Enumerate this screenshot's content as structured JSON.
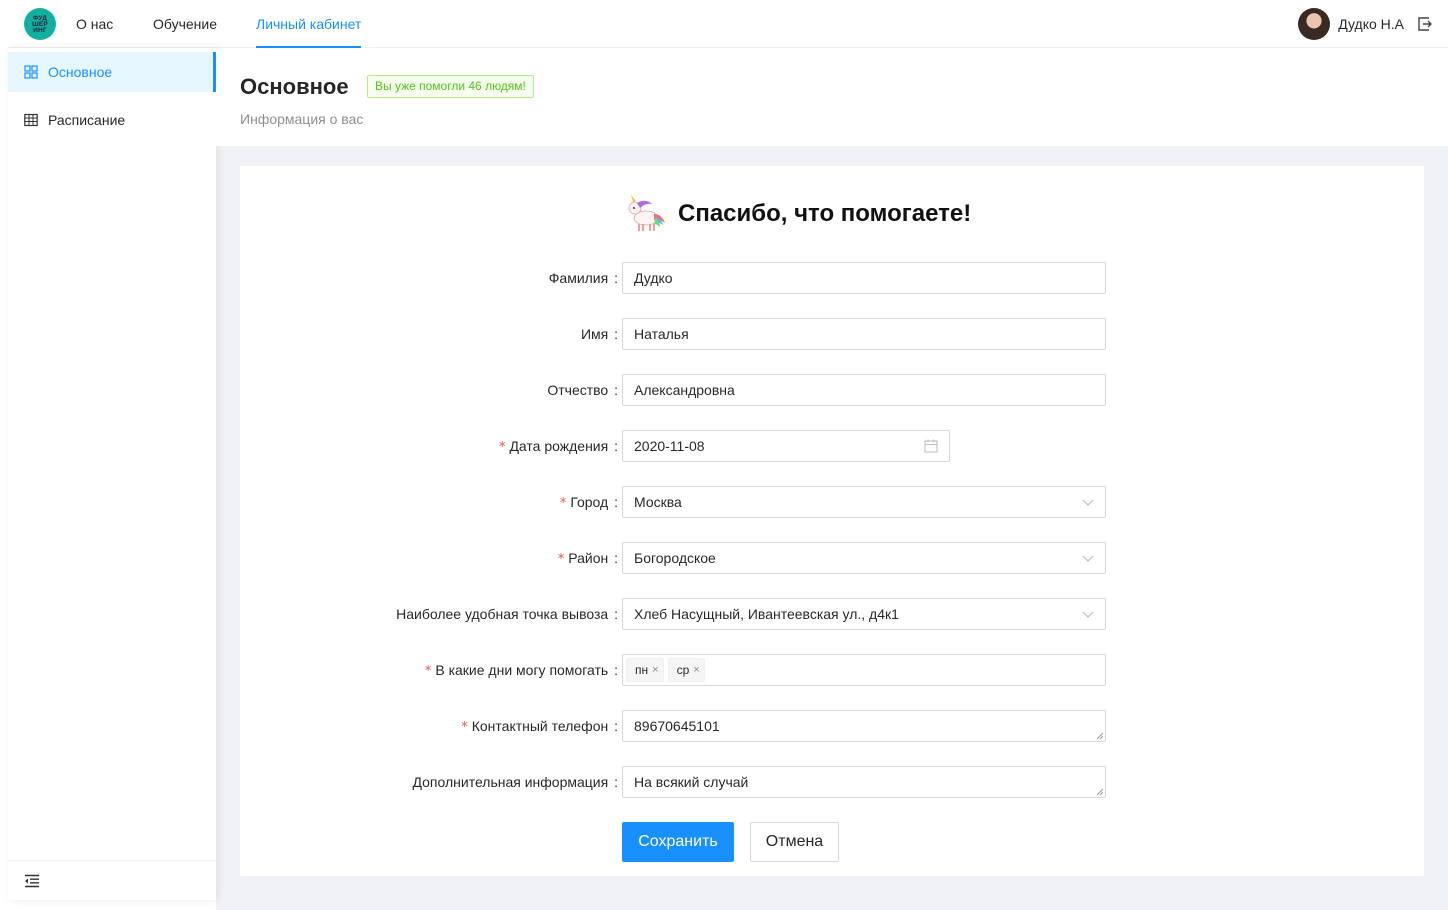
{
  "header": {
    "logo_lines": [
      "ФУД",
      "ШЕР",
      "ИНГ"
    ],
    "nav": [
      {
        "label": "О нас"
      },
      {
        "label": "Обучение"
      },
      {
        "label": "Личный кабинет",
        "active": true
      }
    ],
    "user_name": "Дудко Н.А"
  },
  "sidebar": {
    "items": [
      {
        "label": "Основное",
        "icon": "dashboard-icon",
        "active": true
      },
      {
        "label": "Расписание",
        "icon": "table-icon"
      }
    ]
  },
  "page": {
    "title": "Основное",
    "badge": "Вы уже помогли 46 людям!",
    "subtitle": "Информация о вас"
  },
  "form": {
    "title": "Спасибо, что помогаете!",
    "fields": [
      {
        "label": "Фамилия",
        "value": "Дудко",
        "required": false
      },
      {
        "label": "Имя",
        "value": "Наталья",
        "required": false
      },
      {
        "label": "Отчество",
        "value": "Александровна",
        "required": false
      },
      {
        "label": "Дата рождения",
        "value": "2020-11-08",
        "required": true
      },
      {
        "label": "Город",
        "value": "Москва",
        "required": true
      },
      {
        "label": "Район",
        "value": "Богородское",
        "required": true
      },
      {
        "label": "Наиболее удобная точка вывоза",
        "value": "Хлеб Насущный, Ивантеевская ул., д4к1",
        "required": false
      },
      {
        "label": "В какие дни могу помогать",
        "tags": [
          "пн",
          "ср"
        ],
        "required": true
      },
      {
        "label": "Контактный телефон",
        "value": "89670645101",
        "required": true
      },
      {
        "label": "Дополнительная информация",
        "value": "На всякий случай",
        "required": false
      }
    ],
    "required_mark": "*",
    "label_colon": ":",
    "tag_close": "×",
    "save_label": "Сохранить",
    "cancel_label": "Отмена"
  },
  "colors": {
    "primary": "#1890ff",
    "success": "#52c41a",
    "required": "#ff4d4f",
    "logo": "#13b0a0"
  }
}
